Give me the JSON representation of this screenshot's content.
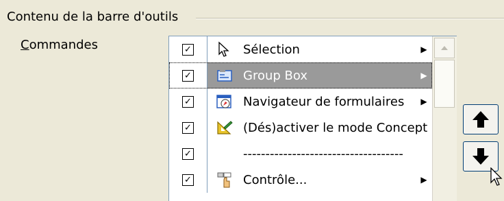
{
  "group": {
    "title": "Contenu de la barre d'outils"
  },
  "commands": {
    "label_mnemonic": "C",
    "label_rest": "ommandes"
  },
  "list": {
    "items": [
      {
        "label": "Sélection",
        "checked": true,
        "icon": "cursor-arrow-icon",
        "has_submenu": true,
        "selected": false
      },
      {
        "label": "Group Box",
        "checked": true,
        "icon": "group-box-icon",
        "has_submenu": true,
        "selected": true
      },
      {
        "label": "Navigateur de formulaires",
        "checked": true,
        "icon": "form-navigator-icon",
        "has_submenu": true,
        "selected": false
      },
      {
        "label": "(Dés)activer le mode Concept",
        "checked": true,
        "icon": "design-mode-icon",
        "has_submenu": false,
        "selected": false
      },
      {
        "label": "------------------------------------",
        "checked": true,
        "icon": "",
        "has_submenu": false,
        "selected": false
      },
      {
        "label": "Contrôle...",
        "checked": true,
        "icon": "control-icon",
        "has_submenu": true,
        "selected": false
      }
    ],
    "check_glyph": "✓",
    "submenu_glyph": "▶"
  },
  "buttons": {
    "move_up_icon": "arrow-up-icon",
    "move_down_icon": "arrow-down-icon"
  }
}
